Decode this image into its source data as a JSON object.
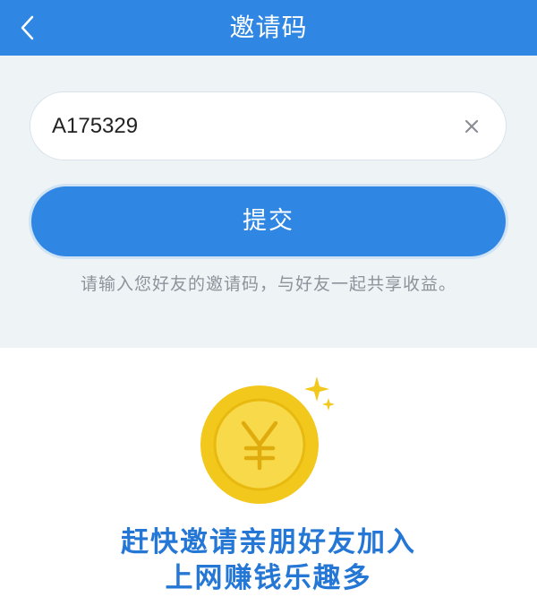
{
  "header": {
    "title": "邀请码",
    "back_icon": "chevron-left-icon",
    "background_color": "#2f87e3"
  },
  "form": {
    "invite_code_value": "A175329",
    "clear_icon": "close-icon",
    "submit_label": "提交",
    "hint": "请输入您好友的邀请码，与好友一起共享收益。"
  },
  "promo": {
    "coin_icon": "yen-coin-icon",
    "sparkle_icon": "sparkle-icon",
    "line1": "赶快邀请亲朋好友加入",
    "line2": "上网赚钱乐趣多",
    "text_color": "#2577d6"
  }
}
